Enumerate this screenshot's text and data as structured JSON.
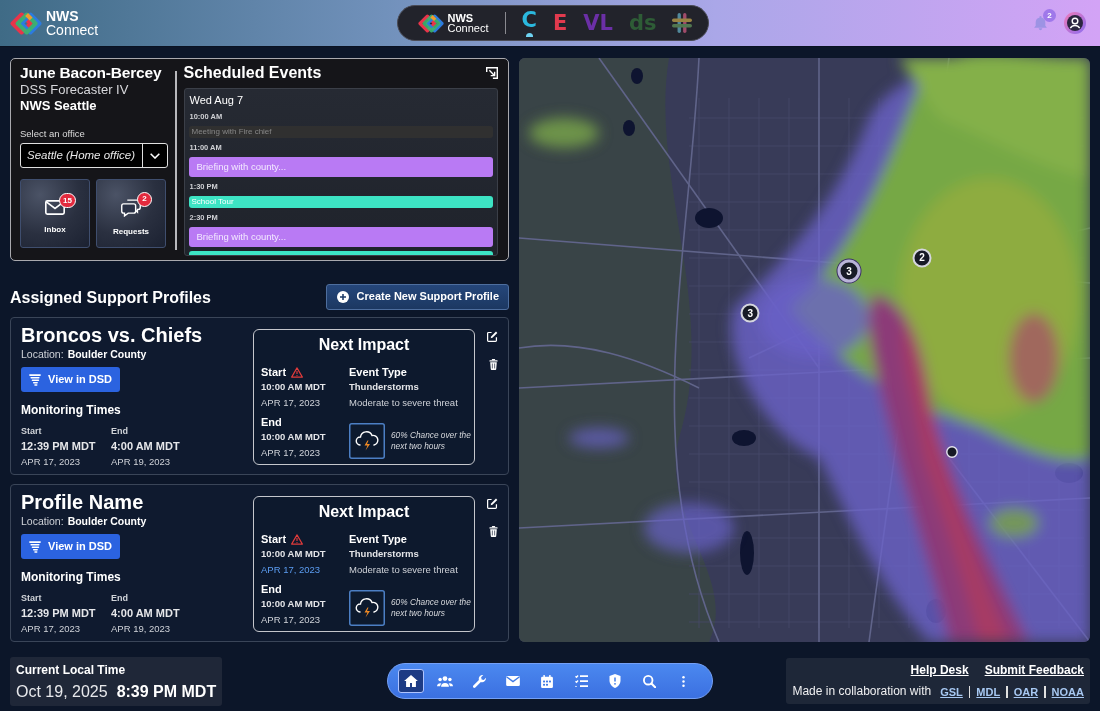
{
  "top_bar": {
    "logo": {
      "line1": "NWS",
      "line2": "Connect"
    },
    "app_switcher": {
      "logo": {
        "line1": "NWS",
        "line2": "Connect"
      },
      "apps": [
        {
          "kind": "letter",
          "label": "C",
          "color": "#2bb8de",
          "selected": true
        },
        {
          "kind": "letter",
          "label": "E",
          "color": "#e23a4e",
          "selected": false
        },
        {
          "kind": "letter",
          "label": "VL",
          "color": "#6b2fa6",
          "selected": false
        },
        {
          "kind": "letter",
          "label": "ds",
          "color": "#2e5c36",
          "selected": false
        },
        {
          "kind": "hash",
          "selected": false
        }
      ]
    },
    "notifications": {
      "count": "2"
    }
  },
  "user_card": {
    "name": "June Bacon-Bercey",
    "role": "DSS Forecaster IV",
    "office": "NWS Seattle",
    "office_select": {
      "label": "Select an office",
      "value": "Seattle (Home office)"
    },
    "tiles": [
      {
        "kind": "inbox",
        "label": "Inbox",
        "count": "15"
      },
      {
        "kind": "requests",
        "label": "Requests",
        "count": "2"
      }
    ]
  },
  "scheduled_events": {
    "title": "Scheduled Events",
    "day": "Wed Aug 7",
    "items": [
      {
        "kind": "time",
        "text": "10:00 AM"
      },
      {
        "kind": "chip",
        "title": "Meeting with Fire chief",
        "color": "#303036",
        "disabled": true
      },
      {
        "kind": "time",
        "text": "11:00 AM"
      },
      {
        "kind": "block",
        "title": "Briefing with county...",
        "color": "#b97af4",
        "disabled": false
      },
      {
        "kind": "time",
        "text": "1:30 PM"
      },
      {
        "kind": "chip",
        "title": "School Tour",
        "color": "#3de4c4",
        "disabled": false
      },
      {
        "kind": "time",
        "text": "2:30 PM"
      },
      {
        "kind": "block",
        "title": "Briefing with county...",
        "color": "#b97af4",
        "disabled": false
      },
      {
        "kind": "chip",
        "color": "#3de4c4",
        "disabled": false
      }
    ]
  },
  "support_profiles": {
    "title": "Assigned Support Profiles",
    "create_button": "Create New Support Profile",
    "profiles": [
      {
        "name": "Broncos vs. Chiefs",
        "location_label": "Location:",
        "location": "Boulder County",
        "button": "View in DSD",
        "monitoring": {
          "title": "Monitoring Times",
          "start": {
            "label": "Start",
            "time": "12:39 PM MDT",
            "date": "APR 17, 2023"
          },
          "end": {
            "label": "End",
            "time": "4:00 AM MDT",
            "date": "APR 19, 2023"
          }
        },
        "next_impact": {
          "title": "Next Impact",
          "start": {
            "label": "Start",
            "warning": true,
            "time": "10:00 AM MDT",
            "date": "APR 17, 2023",
            "highlighted": false
          },
          "end": {
            "label": "End",
            "time": "10:00 AM MDT",
            "date": "APR 17, 2023",
            "highlighted": false
          },
          "event_type": {
            "label": "Event Type",
            "name": "Thunderstorms",
            "severity": "Moderate to severe threat",
            "chance": "60% Chance over the next two hours"
          }
        }
      },
      {
        "name": "Profile Name",
        "location_label": "Location:",
        "location": "Boulder County",
        "button": "View in DSD",
        "monitoring": {
          "title": "Monitoring Times",
          "start": {
            "label": "Start",
            "time": "12:39 PM MDT",
            "date": "APR 17, 2023"
          },
          "end": {
            "label": "End",
            "time": "4:00 AM MDT",
            "date": "APR 19, 2023"
          }
        },
        "next_impact": {
          "title": "Next Impact",
          "start": {
            "label": "Start",
            "warning": true,
            "time": "10:00 AM MDT",
            "date": "APR 17, 2023",
            "highlighted": true
          },
          "end": {
            "label": "End",
            "time": "10:00 AM MDT",
            "date": "APR 17, 2023",
            "highlighted": false
          },
          "event_type": {
            "label": "Event Type",
            "name": "Thunderstorms",
            "severity": "Moderate to severe threat",
            "chance": "60% Chance over the next two hours"
          }
        }
      }
    ]
  },
  "map": {
    "markers": [
      {
        "kind": "cluster",
        "label": "3",
        "selected": true
      },
      {
        "kind": "cluster",
        "label": "2",
        "selected": false
      },
      {
        "kind": "cluster",
        "label": "3",
        "selected": false
      },
      {
        "kind": "point",
        "selected": false
      }
    ]
  },
  "footer": {
    "local_time": {
      "label": "Current Local Time",
      "date": "Oct 19, 2025",
      "time": "8:39 PM MDT"
    },
    "nav": [
      {
        "kind": "home",
        "selected": true
      },
      {
        "kind": "people",
        "selected": false
      },
      {
        "kind": "tools",
        "selected": false
      },
      {
        "kind": "mail",
        "selected": false
      },
      {
        "kind": "calendar",
        "selected": false
      },
      {
        "kind": "list",
        "selected": false
      },
      {
        "kind": "shield",
        "selected": false
      },
      {
        "kind": "search",
        "selected": false
      },
      {
        "kind": "more",
        "selected": false
      }
    ],
    "links": [
      "Help Desk",
      "Submit Feedback"
    ],
    "credit": "Made in collaboration with",
    "partners": [
      "GSL",
      "MDL",
      "OAR",
      "NOAA"
    ]
  }
}
